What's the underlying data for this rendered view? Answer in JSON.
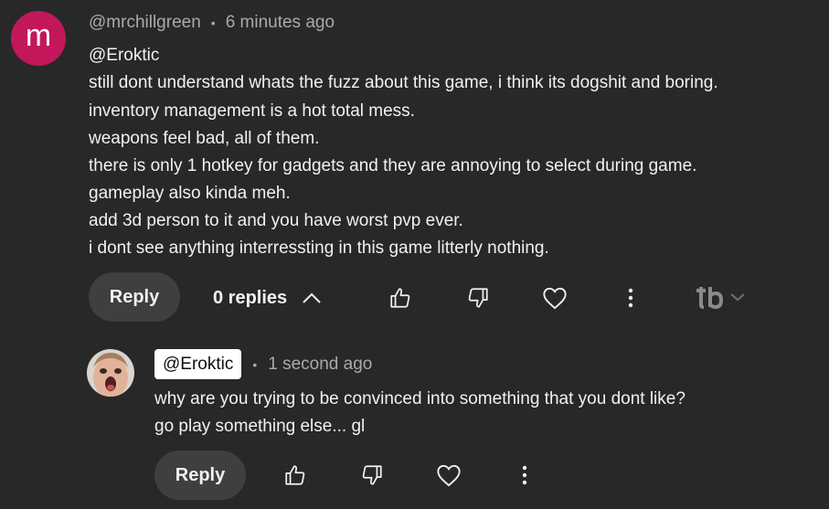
{
  "comment": {
    "avatar_letter": "m",
    "avatar_color": "#c2185b",
    "author": "@mrchillgreen",
    "separator": "•",
    "timestamp": "6 minutes ago",
    "lines": [
      "@Eroktic",
      "still dont understand whats the fuzz about this game, i think its dogshit and boring.",
      "inventory management is a hot total mess.",
      "weapons feel bad, all of them.",
      "there is only 1 hotkey for gadgets and they are annoying to select during game.",
      "gameplay also kinda meh.",
      "add 3d person to it and you have worst pvp ever.",
      "i dont see anything interressting in this game litterly nothing."
    ],
    "actions": {
      "reply_label": "Reply",
      "replies_label": "0 replies",
      "like_icon": "thumbs-up-icon",
      "dislike_icon": "thumbs-down-icon",
      "heart_icon": "heart-icon",
      "more_icon": "more-vert-icon",
      "extension_icon": "tb-logo-icon"
    }
  },
  "reply": {
    "author": "@Eroktic",
    "separator": "•",
    "timestamp": "1 second ago",
    "lines": [
      "why are you trying to be convinced into something that you dont like?",
      "go play something else... gl"
    ],
    "actions": {
      "reply_label": "Reply"
    }
  },
  "colors": {
    "background": "#282828",
    "button_bg": "#3f3f3f",
    "meta_text": "#aaaaaa",
    "text": "#f1f1f1"
  }
}
